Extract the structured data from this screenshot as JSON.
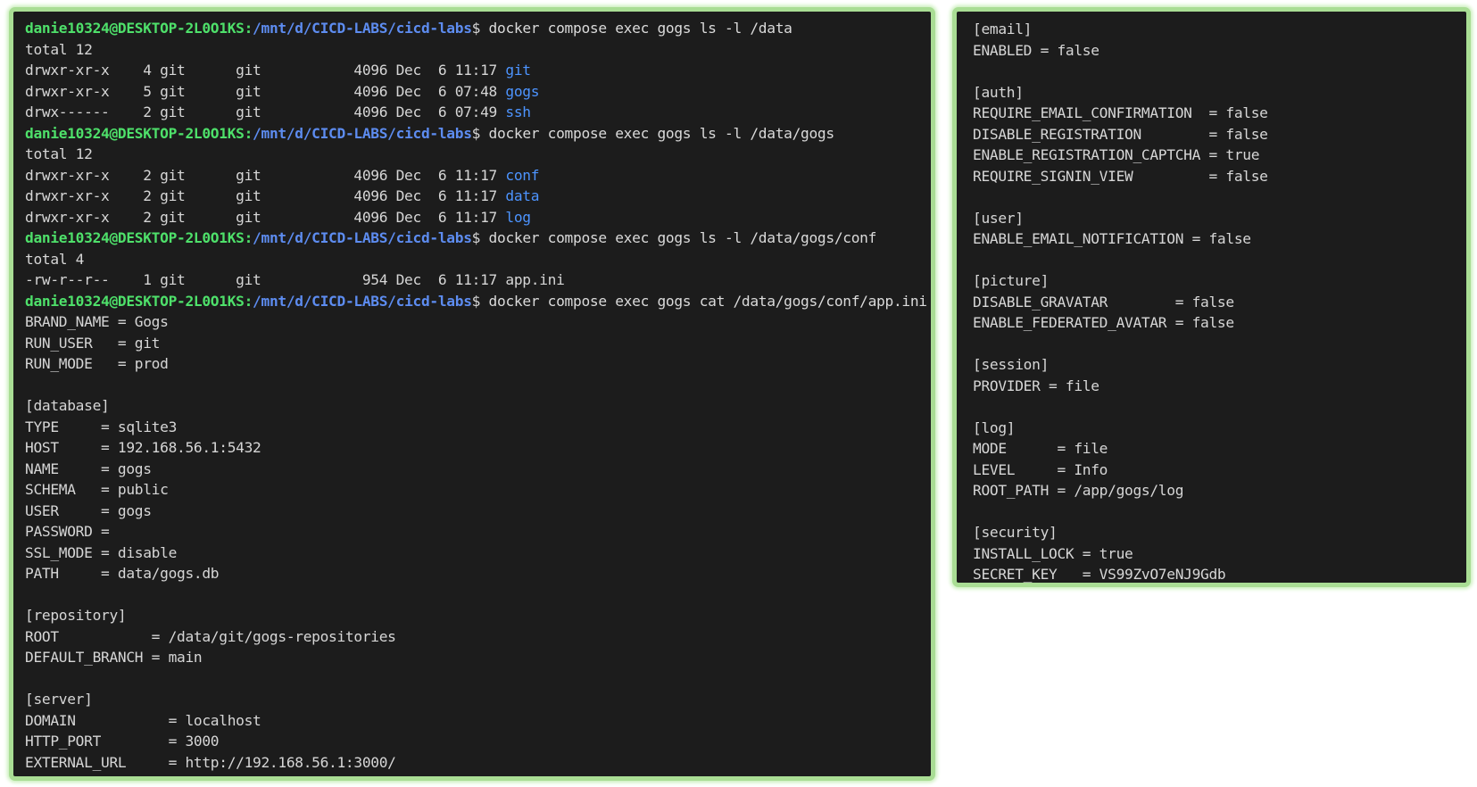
{
  "left_terminal": {
    "lines": [
      {
        "kind": "prompt",
        "user": "danie10324@DESKTOP-2L0O1KS",
        "path": "/mnt/d/CICD-LABS/cicd-labs",
        "cmd": "docker compose exec gogs ls -l /data"
      },
      {
        "kind": "text",
        "text": "total 12"
      },
      {
        "kind": "entry",
        "prefix": "drwxr-xr-x    4 git      git           4096 Dec  6 11:17 ",
        "name": "git",
        "dir": true
      },
      {
        "kind": "entry",
        "prefix": "drwxr-xr-x    5 git      git           4096 Dec  6 07:48 ",
        "name": "gogs",
        "dir": true
      },
      {
        "kind": "entry",
        "prefix": "drwx------    2 git      git           4096 Dec  6 07:49 ",
        "name": "ssh",
        "dir": true
      },
      {
        "kind": "prompt",
        "user": "danie10324@DESKTOP-2L0O1KS",
        "path": "/mnt/d/CICD-LABS/cicd-labs",
        "cmd": "docker compose exec gogs ls -l /data/gogs"
      },
      {
        "kind": "text",
        "text": "total 12"
      },
      {
        "kind": "entry",
        "prefix": "drwxr-xr-x    2 git      git           4096 Dec  6 11:17 ",
        "name": "conf",
        "dir": true
      },
      {
        "kind": "entry",
        "prefix": "drwxr-xr-x    2 git      git           4096 Dec  6 11:17 ",
        "name": "data",
        "dir": true
      },
      {
        "kind": "entry",
        "prefix": "drwxr-xr-x    2 git      git           4096 Dec  6 11:17 ",
        "name": "log",
        "dir": true
      },
      {
        "kind": "prompt",
        "user": "danie10324@DESKTOP-2L0O1KS",
        "path": "/mnt/d/CICD-LABS/cicd-labs",
        "cmd": "docker compose exec gogs ls -l /data/gogs/conf"
      },
      {
        "kind": "text",
        "text": "total 4"
      },
      {
        "kind": "entry",
        "prefix": "-rw-r--r--    1 git      git            954 Dec  6 11:17 ",
        "name": "app.ini",
        "dir": false
      },
      {
        "kind": "prompt",
        "user": "danie10324@DESKTOP-2L0O1KS",
        "path": "/mnt/d/CICD-LABS/cicd-labs",
        "cmd": "docker compose exec gogs cat /data/gogs/conf/app.ini"
      },
      {
        "kind": "text",
        "text": "BRAND_NAME = Gogs"
      },
      {
        "kind": "text",
        "text": "RUN_USER   = git"
      },
      {
        "kind": "text",
        "text": "RUN_MODE   = prod"
      },
      {
        "kind": "text",
        "text": ""
      },
      {
        "kind": "text",
        "text": "[database]"
      },
      {
        "kind": "text",
        "text": "TYPE     = sqlite3"
      },
      {
        "kind": "text",
        "text": "HOST     = 192.168.56.1:5432"
      },
      {
        "kind": "text",
        "text": "NAME     = gogs"
      },
      {
        "kind": "text",
        "text": "SCHEMA   = public"
      },
      {
        "kind": "text",
        "text": "USER     = gogs"
      },
      {
        "kind": "text",
        "text": "PASSWORD ="
      },
      {
        "kind": "text",
        "text": "SSL_MODE = disable"
      },
      {
        "kind": "text",
        "text": "PATH     = data/gogs.db"
      },
      {
        "kind": "text",
        "text": ""
      },
      {
        "kind": "text",
        "text": "[repository]"
      },
      {
        "kind": "text",
        "text": "ROOT           = /data/git/gogs-repositories"
      },
      {
        "kind": "text",
        "text": "DEFAULT_BRANCH = main"
      },
      {
        "kind": "text",
        "text": ""
      },
      {
        "kind": "text",
        "text": "[server]"
      },
      {
        "kind": "text",
        "text": "DOMAIN           = localhost"
      },
      {
        "kind": "text",
        "text": "HTTP_PORT        = 3000"
      },
      {
        "kind": "text",
        "text": "EXTERNAL_URL     = http://192.168.56.1:3000/"
      }
    ]
  },
  "right_terminal": {
    "lines": [
      {
        "kind": "text",
        "text": "[email]"
      },
      {
        "kind": "text",
        "text": "ENABLED = false"
      },
      {
        "kind": "text",
        "text": ""
      },
      {
        "kind": "text",
        "text": "[auth]"
      },
      {
        "kind": "text",
        "text": "REQUIRE_EMAIL_CONFIRMATION  = false"
      },
      {
        "kind": "text",
        "text": "DISABLE_REGISTRATION        = false"
      },
      {
        "kind": "text",
        "text": "ENABLE_REGISTRATION_CAPTCHA = true"
      },
      {
        "kind": "text",
        "text": "REQUIRE_SIGNIN_VIEW         = false"
      },
      {
        "kind": "text",
        "text": ""
      },
      {
        "kind": "text",
        "text": "[user]"
      },
      {
        "kind": "text",
        "text": "ENABLE_EMAIL_NOTIFICATION = false"
      },
      {
        "kind": "text",
        "text": ""
      },
      {
        "kind": "text",
        "text": "[picture]"
      },
      {
        "kind": "text",
        "text": "DISABLE_GRAVATAR        = false"
      },
      {
        "kind": "text",
        "text": "ENABLE_FEDERATED_AVATAR = false"
      },
      {
        "kind": "text",
        "text": ""
      },
      {
        "kind": "text",
        "text": "[session]"
      },
      {
        "kind": "text",
        "text": "PROVIDER = file"
      },
      {
        "kind": "text",
        "text": ""
      },
      {
        "kind": "text",
        "text": "[log]"
      },
      {
        "kind": "text",
        "text": "MODE      = file"
      },
      {
        "kind": "text",
        "text": "LEVEL     = Info"
      },
      {
        "kind": "text",
        "text": "ROOT_PATH = /app/gogs/log"
      },
      {
        "kind": "text",
        "text": ""
      },
      {
        "kind": "text",
        "text": "[security]"
      },
      {
        "kind": "text",
        "text": "INSTALL_LOCK = true"
      },
      {
        "kind": "text",
        "text": "SECRET_KEY   = VS99ZvO7eNJ9Gdb"
      }
    ]
  },
  "colors": {
    "terminal_bg": "#1c1c1c",
    "frame_border": "#a9dd94",
    "prompt_user": "#4ee06a",
    "prompt_path": "#5d8cf0",
    "directory": "#4d94ff",
    "text": "#d6d6d6"
  }
}
